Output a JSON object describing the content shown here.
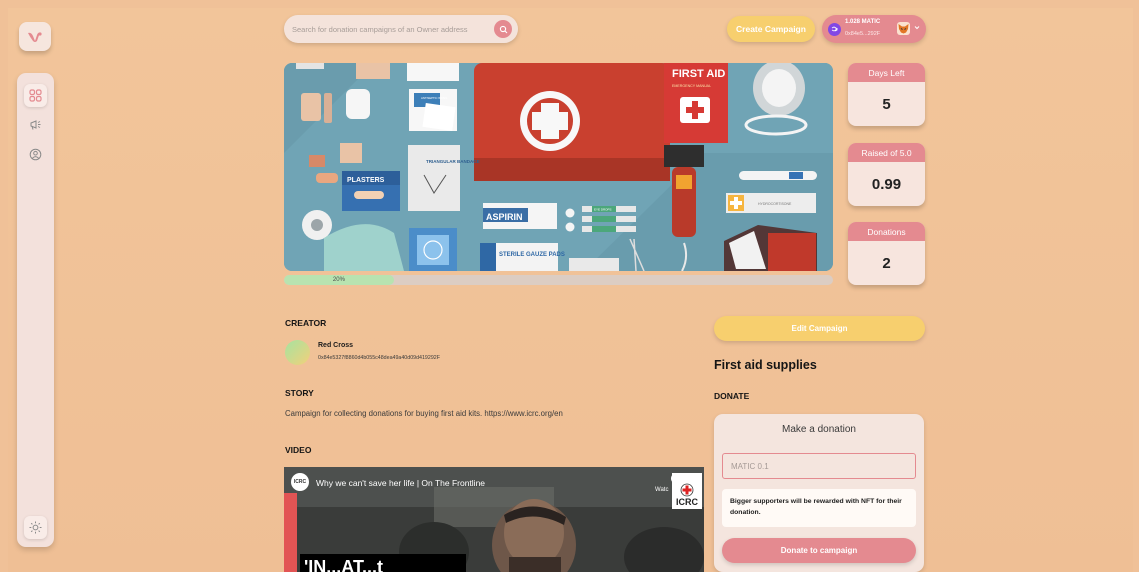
{
  "header": {
    "search_placeholder": "Search for donation campaigns of an Owner address",
    "create_campaign_label": "Create Campaign",
    "wallet": {
      "balance": "1.028 MATIC",
      "address": "0x84e5...292F"
    }
  },
  "sidebar": {
    "items": [
      {
        "icon": "dashboard-icon",
        "active": true
      },
      {
        "icon": "megaphone-icon",
        "active": false
      },
      {
        "icon": "profile-icon",
        "active": false
      }
    ],
    "theme_icon": "sun-icon"
  },
  "campaign": {
    "image_alt": "First aid kit flat lay",
    "progress_label": "20%",
    "progress_fraction": 0.2,
    "stats": [
      {
        "label": "Days Left",
        "value": "5"
      },
      {
        "label": "Raised of 5.0",
        "value": "0.99"
      },
      {
        "label": "Donations",
        "value": "2"
      }
    ],
    "hero_text": {
      "first_aid": "FIRST AID",
      "emergency_manual": "EMERGENCY MANUAL",
      "plasters": "PLASTERS",
      "triangular_bandage": "TRIANGULAR BANDAGE",
      "aspirin": "ASPIRIN",
      "sterile_gauze": "STERILE GAUZE PADS",
      "hydrocortisone": "HYDROCORTISONE",
      "antiseptic": "ANTISEPTIC WIPES",
      "eye_drops": "EYE DROPS"
    }
  },
  "creator": {
    "heading": "CREATOR",
    "name": "Red Cross",
    "address": "0x84e5327f8860d4b055c48dea49a40d09d419292F"
  },
  "story": {
    "heading": "STORY",
    "text": "Campaign for collecting donations for buying first aid kits. https://www.icrc.org/en"
  },
  "video": {
    "heading": "VIDEO",
    "title": "Why we can't save her life | On The Frontline",
    "watch_label": "Watc",
    "channel_badge": "ICRC",
    "channel_small": "ICRC",
    "overlay_text": "'IN...AT...t"
  },
  "side": {
    "edit_label": "Edit Campaign",
    "title": "First aid supplies",
    "donate_heading": "DONATE",
    "card_title": "Make a donation",
    "amount_placeholder": "MATIC 0.1",
    "reward_text": "Bigger supporters will be rewarded with NFT for their donation.",
    "donate_button": "Donate to campaign"
  },
  "colors": {
    "background": "#f0c198",
    "accent_pink": "#e48a90",
    "accent_yellow": "#f7cf6e",
    "card": "#f4e5de",
    "progress_fill": "#b8e3b0"
  }
}
